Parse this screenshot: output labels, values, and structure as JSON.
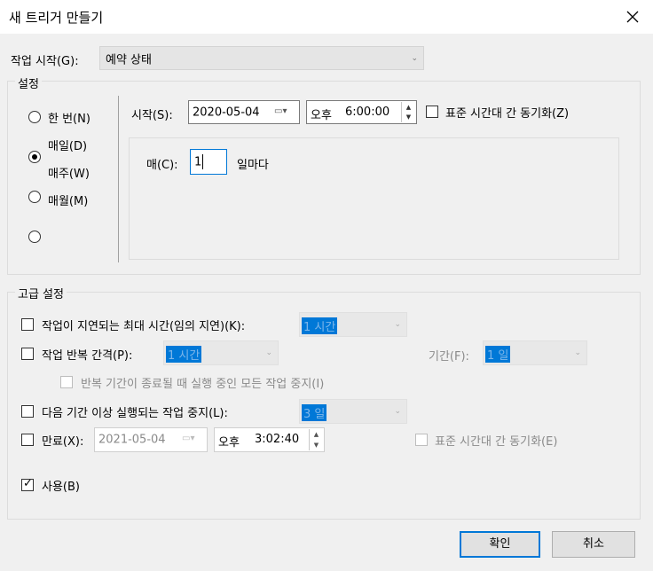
{
  "window": {
    "title": "새 트리거 만들기",
    "close_icon": "close-icon"
  },
  "start_task": {
    "label": "작업 시작(G):",
    "value": "예약 상태"
  },
  "settings": {
    "group_label": "설정",
    "radios": [
      {
        "label": "한 번(N)",
        "checked": false
      },
      {
        "label": "매일(D)",
        "checked": true
      },
      {
        "label": "매주(W)",
        "checked": false
      },
      {
        "label": "매월(M)",
        "checked": false
      }
    ],
    "start_label": "시작(S):",
    "start_date": "2020-05-04",
    "start_ampm": "오후",
    "start_time": "6:00:00",
    "sync_label": "표준 시간대 간 동기화(Z)",
    "every_label": "매(C):",
    "every_value": "1",
    "every_unit": "일마다"
  },
  "advanced": {
    "group_label": "고급 설정",
    "delay_label": "작업이 지연되는 최대 시간(임의 지연)(K):",
    "delay_value": "1 시간",
    "repeat_label": "작업 반복 간격(P):",
    "repeat_value": "1 시간",
    "duration_label": "기간(F):",
    "duration_value": "1 일",
    "stop_all_label": "반복 기간이 종료될 때 실행 중인 모든 작업 중지(I)",
    "stop_longer_label": "다음 기간 이상 실행되는 작업 중지(L):",
    "stop_longer_value": "3 일",
    "expire_label": "만료(X):",
    "expire_date": "2021-05-04",
    "expire_ampm": "오후",
    "expire_time": "3:02:40",
    "expire_sync_label": "표준 시간대 간 동기화(E)",
    "enabled_label": "사용(B)",
    "enabled_checked": true
  },
  "buttons": {
    "ok": "확인",
    "cancel": "취소"
  }
}
